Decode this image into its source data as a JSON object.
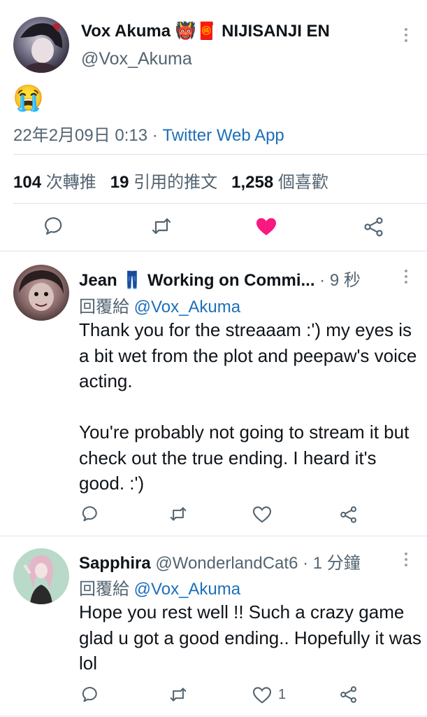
{
  "main_tweet": {
    "display_name": "Vox Akuma",
    "name_emoji": "👹🧧",
    "org": "NIJISANJI EN",
    "handle": "@Vox_Akuma",
    "content_emoji": "😭",
    "timestamp": "22年2月09日 0:13",
    "separator": "·",
    "source": "Twitter Web App",
    "stats": {
      "retweets_num": "104",
      "retweets_label": "次轉推",
      "quotes_num": "19",
      "quotes_label": "引用的推文",
      "likes_num": "1,258",
      "likes_label": "個喜歡"
    },
    "icons": [
      "reply-icon",
      "retweet-icon",
      "like-icon-filled",
      "share-icon"
    ],
    "like_color": "#f91880"
  },
  "replies": [
    {
      "display_name": "Jean",
      "name_emoji": "👖",
      "name_rest": "Working on Commi...",
      "time": "· 9 秒",
      "reply_prefix": "回覆給",
      "reply_to": "@Vox_Akuma",
      "text": "Thank you for the streaaam :') my eyes is a bit wet from the plot and peepaw's voice acting.\n\nYou're probably not going to stream it but check out the true ending. I heard it's good. :')",
      "like_count": ""
    },
    {
      "display_name": "Sapphira",
      "handle": "@WonderlandCat6",
      "time": "· 1 分鐘",
      "reply_prefix": "回覆給",
      "reply_to": "@Vox_Akuma",
      "text": "Hope you rest well !! Such a crazy game glad u got a good ending.. Hopefully it was lol",
      "like_count": "1"
    }
  ],
  "colors": {
    "link": "#1d6fb8",
    "secondary": "#536471",
    "divider": "#dfe3e6"
  }
}
